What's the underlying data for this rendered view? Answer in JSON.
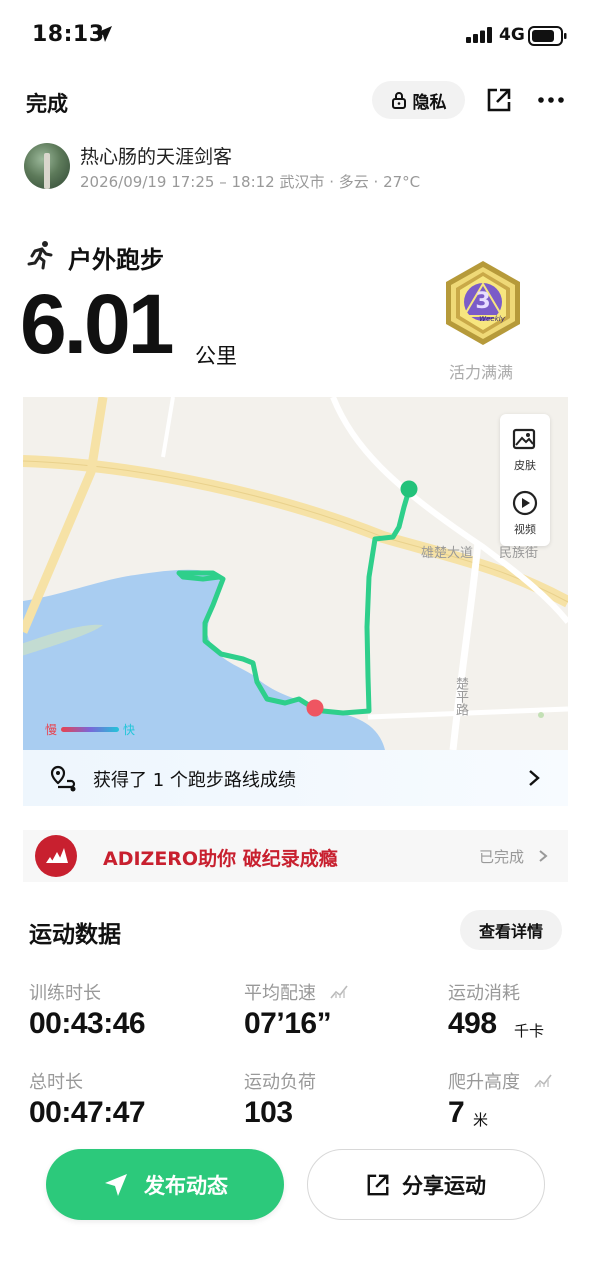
{
  "status_bar": {
    "time": "18:13",
    "network": "4G"
  },
  "header": {
    "title": "完成",
    "privacy_label": "隐私"
  },
  "user": {
    "name": "热心肠的天涯剑客",
    "meta": "2026/09/19 17:25 – 18:12 武汉市 · 多云 · 27°C"
  },
  "activity": {
    "type": "户外跑步",
    "distance": "6.01",
    "distance_unit": "公里",
    "badge_text": "Weekly",
    "badge_label": "活力满满"
  },
  "map": {
    "tools": [
      {
        "label": "皮肤",
        "icon": "image-icon"
      },
      {
        "label": "视频",
        "icon": "play-icon"
      }
    ],
    "legend": {
      "slow": "慢",
      "fast": "快"
    },
    "road_labels": {
      "main": "雄楚大道",
      "main_suffix": "民族街",
      "side": "楚平路"
    },
    "colors": {
      "route": "#2ecf8b",
      "start": "#ef5561",
      "end": "#22c27a",
      "water": "#a9cdf1",
      "road": "#f6e2a6"
    }
  },
  "route_achievement": {
    "text": "获得了 1 个跑步路线成绩"
  },
  "promo": {
    "text": "ADIZERO助你 破纪录成瘾",
    "status": "已完成",
    "color": "#c8202f"
  },
  "stats": {
    "title": "运动数据",
    "detail_button": "查看详情",
    "items": [
      {
        "label": "训练时长",
        "value": "00:43:46",
        "unit": ""
      },
      {
        "label": "平均配速",
        "value": "07’16”",
        "unit": ""
      },
      {
        "label": "运动消耗",
        "value": "498",
        "unit": "千卡"
      },
      {
        "label": "总时长",
        "value": "00:47:47",
        "unit": ""
      },
      {
        "label": "运动负荷",
        "value": "103",
        "unit": ""
      },
      {
        "label": "爬升高度",
        "value": "7",
        "unit": "米"
      }
    ]
  },
  "actions": {
    "publish": "发布动态",
    "share": "分享运动",
    "accent": "#2cc97b"
  }
}
